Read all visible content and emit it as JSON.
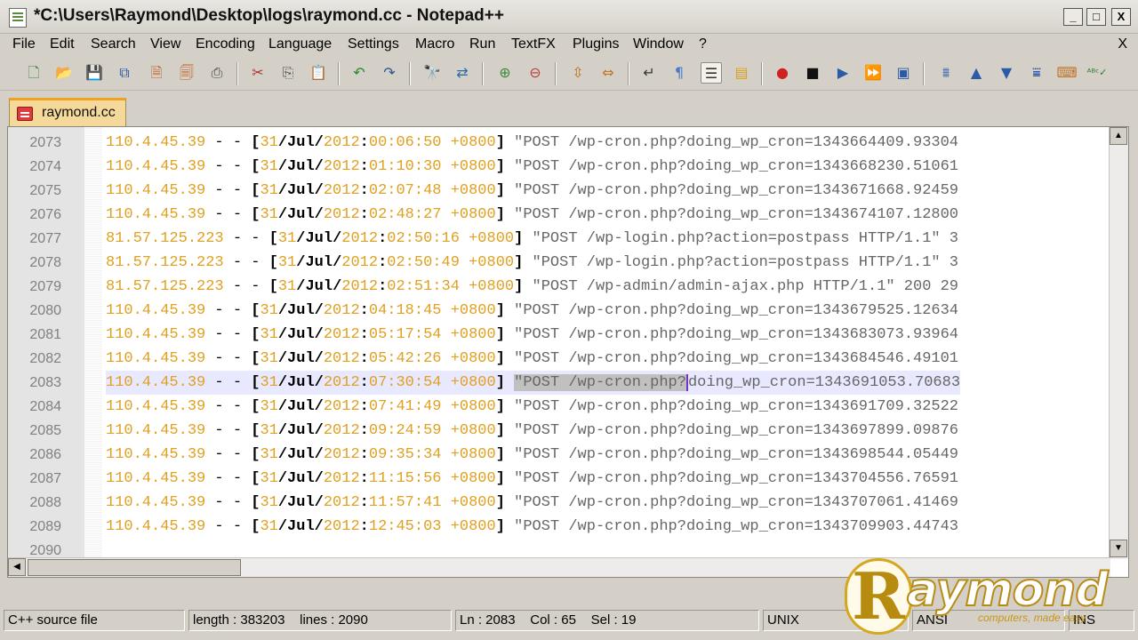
{
  "window": {
    "title": "*C:\\Users\\Raymond\\Desktop\\logs\\raymond.cc - Notepad++",
    "controls": {
      "minimize": "_",
      "maximize": "□",
      "close": "X"
    }
  },
  "menu": {
    "items": [
      "File",
      "Edit",
      "Search",
      "View",
      "Encoding",
      "Language",
      "Settings",
      "Macro",
      "Run",
      "TextFX",
      "Plugins",
      "Window",
      "?"
    ],
    "close": "X"
  },
  "toolbar": {
    "icons": [
      "new-file",
      "open",
      "save",
      "save-all",
      "close",
      "close-all",
      "print",
      "cut",
      "copy",
      "paste",
      "undo",
      "redo",
      "find",
      "replace",
      "zoom-in",
      "zoom-out",
      "sync-vertical",
      "sync-horizontal",
      "word-wrap",
      "show-all-chars",
      "indent-guide",
      "user-defined-lang",
      "record-macro",
      "stop-record",
      "play-macro",
      "run-macro-multiple",
      "save-macro",
      "trim-lines",
      "move-up",
      "move-down",
      "sort",
      "spell-check",
      "abc-check"
    ]
  },
  "tabs": [
    {
      "label": "raymond.cc",
      "active": true,
      "modified": true
    }
  ],
  "editor": {
    "lines": [
      {
        "n": "2073",
        "ip": "110.4.45.39",
        "day": "31",
        "mon": "Jul",
        "yr": "2012",
        "time": "00:06:50",
        "tz": "+0800",
        "req": "\"POST /wp-cron.php?doing_wp_cron=1343664409.93304"
      },
      {
        "n": "2074",
        "ip": "110.4.45.39",
        "day": "31",
        "mon": "Jul",
        "yr": "2012",
        "time": "01:10:30",
        "tz": "+0800",
        "req": "\"POST /wp-cron.php?doing_wp_cron=1343668230.51061"
      },
      {
        "n": "2075",
        "ip": "110.4.45.39",
        "day": "31",
        "mon": "Jul",
        "yr": "2012",
        "time": "02:07:48",
        "tz": "+0800",
        "req": "\"POST /wp-cron.php?doing_wp_cron=1343671668.92459"
      },
      {
        "n": "2076",
        "ip": "110.4.45.39",
        "day": "31",
        "mon": "Jul",
        "yr": "2012",
        "time": "02:48:27",
        "tz": "+0800",
        "req": "\"POST /wp-cron.php?doing_wp_cron=1343674107.12800"
      },
      {
        "n": "2077",
        "ip": "81.57.125.223",
        "day": "31",
        "mon": "Jul",
        "yr": "2012",
        "time": "02:50:16",
        "tz": "+0800",
        "req": "\"POST /wp-login.php?action=postpass HTTP/1.1\" 3"
      },
      {
        "n": "2078",
        "ip": "81.57.125.223",
        "day": "31",
        "mon": "Jul",
        "yr": "2012",
        "time": "02:50:49",
        "tz": "+0800",
        "req": "\"POST /wp-login.php?action=postpass HTTP/1.1\" 3"
      },
      {
        "n": "2079",
        "ip": "81.57.125.223",
        "day": "31",
        "mon": "Jul",
        "yr": "2012",
        "time": "02:51:34",
        "tz": "+0800",
        "req": "\"POST /wp-admin/admin-ajax.php HTTP/1.1\" 200 29"
      },
      {
        "n": "2080",
        "ip": "110.4.45.39",
        "day": "31",
        "mon": "Jul",
        "yr": "2012",
        "time": "04:18:45",
        "tz": "+0800",
        "req": "\"POST /wp-cron.php?doing_wp_cron=1343679525.12634"
      },
      {
        "n": "2081",
        "ip": "110.4.45.39",
        "day": "31",
        "mon": "Jul",
        "yr": "2012",
        "time": "05:17:54",
        "tz": "+0800",
        "req": "\"POST /wp-cron.php?doing_wp_cron=1343683073.93964"
      },
      {
        "n": "2082",
        "ip": "110.4.45.39",
        "day": "31",
        "mon": "Jul",
        "yr": "2012",
        "time": "05:42:26",
        "tz": "+0800",
        "req": "\"POST /wp-cron.php?doing_wp_cron=1343684546.49101"
      },
      {
        "n": "2083",
        "ip": "110.4.45.39",
        "day": "31",
        "mon": "Jul",
        "yr": "2012",
        "time": "07:30:54",
        "tz": "+0800",
        "req_sel": "\"POST /wp-cron.php?",
        "req": "doing_wp_cron=1343691053.70683",
        "current": true
      },
      {
        "n": "2084",
        "ip": "110.4.45.39",
        "day": "31",
        "mon": "Jul",
        "yr": "2012",
        "time": "07:41:49",
        "tz": "+0800",
        "req": "\"POST /wp-cron.php?doing_wp_cron=1343691709.32522"
      },
      {
        "n": "2085",
        "ip": "110.4.45.39",
        "day": "31",
        "mon": "Jul",
        "yr": "2012",
        "time": "09:24:59",
        "tz": "+0800",
        "req": "\"POST /wp-cron.php?doing_wp_cron=1343697899.09876"
      },
      {
        "n": "2086",
        "ip": "110.4.45.39",
        "day": "31",
        "mon": "Jul",
        "yr": "2012",
        "time": "09:35:34",
        "tz": "+0800",
        "req": "\"POST /wp-cron.php?doing_wp_cron=1343698544.05449"
      },
      {
        "n": "2087",
        "ip": "110.4.45.39",
        "day": "31",
        "mon": "Jul",
        "yr": "2012",
        "time": "11:15:56",
        "tz": "+0800",
        "req": "\"POST /wp-cron.php?doing_wp_cron=1343704556.76591"
      },
      {
        "n": "2088",
        "ip": "110.4.45.39",
        "day": "31",
        "mon": "Jul",
        "yr": "2012",
        "time": "11:57:41",
        "tz": "+0800",
        "req": "\"POST /wp-cron.php?doing_wp_cron=1343707061.41469"
      },
      {
        "n": "2089",
        "ip": "110.4.45.39",
        "day": "31",
        "mon": "Jul",
        "yr": "2012",
        "time": "12:45:03",
        "tz": "+0800",
        "req": "\"POST /wp-cron.php?doing_wp_cron=1343709903.44743"
      },
      {
        "n": "2090",
        "ip": "",
        "day": "",
        "mon": "",
        "yr": "",
        "time": "",
        "tz": "",
        "req": ""
      }
    ]
  },
  "status": {
    "type": "C++ source file",
    "length": "length : 383203",
    "lines": "lines : 2090",
    "ln": "Ln : 2083",
    "col": "Col : 65",
    "sel": "Sel : 19",
    "eol": "UNIX",
    "encoding": "ANSI",
    "mode": "INS"
  },
  "watermark": {
    "letter": "R",
    "brand": "aymond",
    "tagline": "computers, made easy"
  },
  "colors": {
    "ip": "#e0a020",
    "selection": "#c0c0c0",
    "current_line": "#e8e8ff",
    "tab_accent": "#f2a020"
  }
}
